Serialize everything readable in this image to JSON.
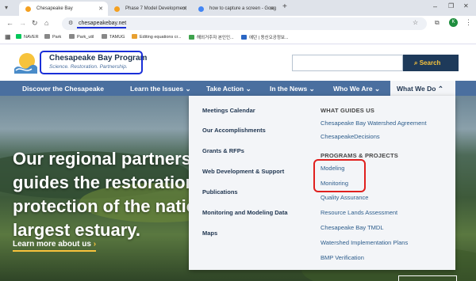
{
  "browser": {
    "tabs": [
      {
        "title": "Chesapeake Bay",
        "active": true,
        "favicon_color": "#f4a020"
      },
      {
        "title": "Phase 7 Model Development",
        "active": false,
        "favicon_color": "#f4a020"
      },
      {
        "title": "how to capture a screen - Goog",
        "active": false,
        "favicon_color": "#4285f4"
      }
    ],
    "new_tab": "+",
    "url": "chesapeakebay.net",
    "profile_initial": "K",
    "bookmarks": [
      "NAVER",
      "Park",
      "Park_util",
      "TAMUG",
      "Editing equations cr...",
      "해외거주자 본인인...",
      "에던 | 동신오공정보..."
    ]
  },
  "site": {
    "logo_title": "Chesapeake Bay Program",
    "logo_tagline": "Science. Restoration. Partnership.",
    "search_placeholder": "",
    "search_button": "Search",
    "nav": [
      "Discover the Chesapeake",
      "Learn the Issues",
      "Take Action",
      "In the News",
      "Who We Are",
      "What We Do"
    ],
    "hero_lines": [
      "Our regional partnersh",
      "guides the restoration",
      "protection of the natio",
      "largest estuary."
    ],
    "hero_link": "Learn more about us",
    "dropdown": {
      "left_links": [
        "Meetings Calendar",
        "Our Accomplishments",
        "Grants & RFPs",
        "Web Development & Support",
        "Publications",
        "Monitoring and Modeling Data",
        "Maps"
      ],
      "heading_guides": "WHAT GUIDES US",
      "guides_links": [
        "Chesapeake Bay Watershed Agreement",
        "ChesapeakeDecisions"
      ],
      "heading_programs": "PROGRAMS & PROJECTS",
      "programs_links": [
        "Modeling",
        "Monitoring",
        "Quality Assurance",
        "Resource Lands Assessment",
        "Chesapeake Bay TMDL",
        "Watershed Implementation Plans",
        "BMP Verification"
      ]
    }
  },
  "colors": {
    "nav": "#4a6f9f",
    "accent_yellow": "#f7c33c",
    "annotation_red": "#e0201e",
    "annotation_blue": "#1a2fd8",
    "search_button": "#1e3a5a"
  }
}
